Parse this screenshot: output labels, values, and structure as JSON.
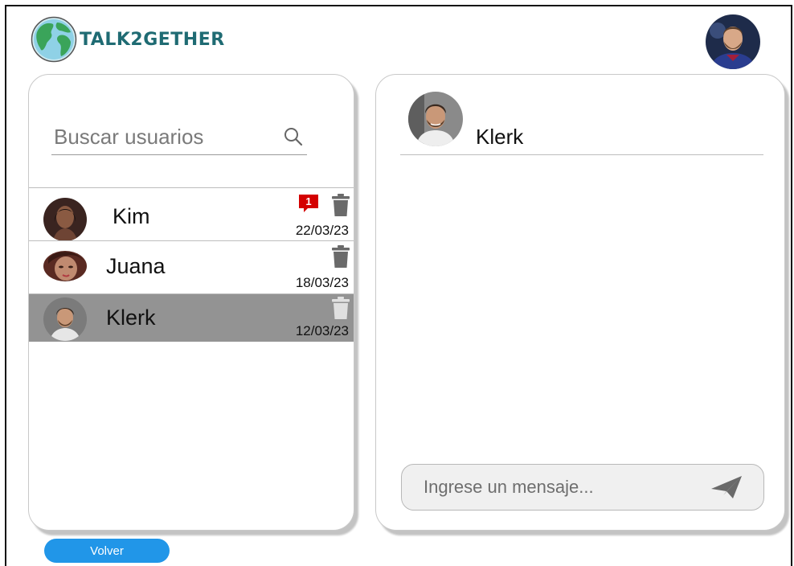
{
  "app": {
    "logo_text": "TALK2GETHER"
  },
  "search": {
    "placeholder": "Buscar usuarios"
  },
  "contacts": [
    {
      "name": "Kim",
      "date": "22/03/23",
      "unread": "1",
      "selected": false
    },
    {
      "name": "Juana",
      "date": "18/03/23",
      "unread": "",
      "selected": false
    },
    {
      "name": "Klerk",
      "date": "12/03/23",
      "unread": "",
      "selected": true
    }
  ],
  "chat": {
    "contact_name": "Klerk",
    "message_placeholder": "Ingrese un mensaje..."
  },
  "footer": {
    "back_label": "Volver"
  },
  "colors": {
    "accent": "#2196e8",
    "logo": "#1f6b73",
    "badge": "#d40000",
    "selected_row": "#939393"
  }
}
